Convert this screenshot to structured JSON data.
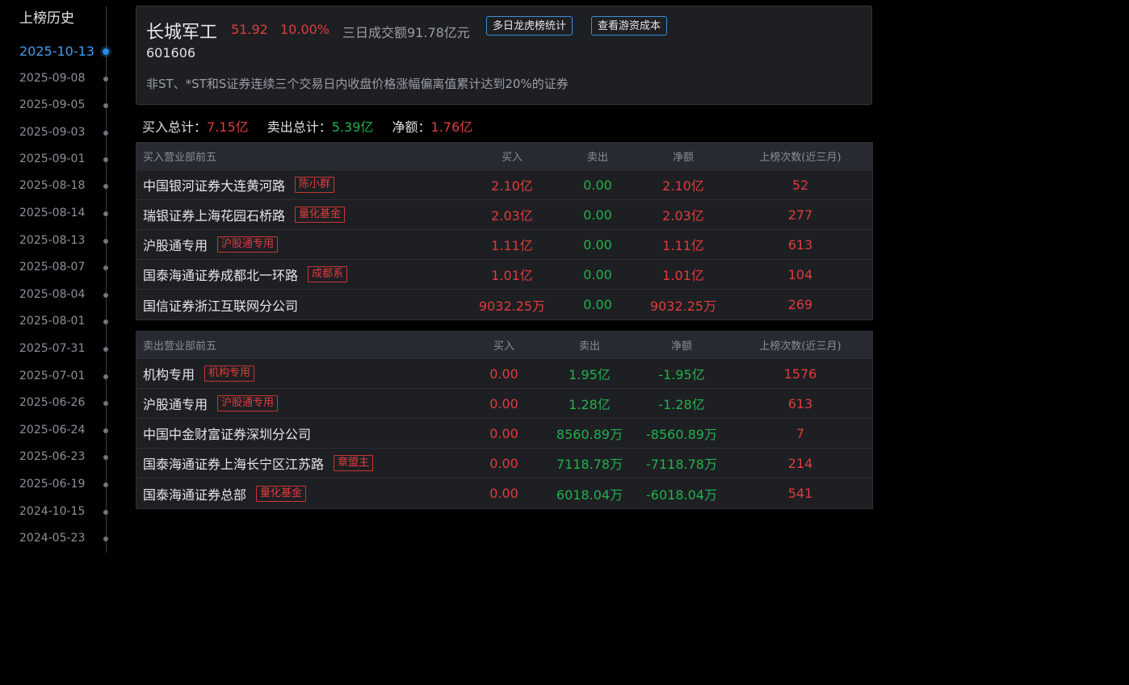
{
  "sidebar": {
    "title": "上榜历史",
    "dates": [
      {
        "label": "2025-10-13",
        "active": true
      },
      {
        "label": "2025-09-08"
      },
      {
        "label": "2025-09-05"
      },
      {
        "label": "2025-09-03"
      },
      {
        "label": "2025-09-01"
      },
      {
        "label": "2025-08-18"
      },
      {
        "label": "2025-08-14"
      },
      {
        "label": "2025-08-13"
      },
      {
        "label": "2025-08-07"
      },
      {
        "label": "2025-08-04"
      },
      {
        "label": "2025-08-01"
      },
      {
        "label": "2025-07-31"
      },
      {
        "label": "2025-07-01"
      },
      {
        "label": "2025-06-26"
      },
      {
        "label": "2025-06-24"
      },
      {
        "label": "2025-06-23"
      },
      {
        "label": "2025-06-19"
      },
      {
        "label": "2024-10-15"
      },
      {
        "label": "2024-05-23"
      }
    ]
  },
  "stock": {
    "name": "长城军工",
    "price": "51.92",
    "change": "10.00%",
    "turnover": "三日成交额91.78亿元",
    "code": "601606",
    "reason": "非ST、*ST和S证券连续三个交易日内收盘价格涨幅偏离值累计达到20%的证券",
    "buttons": {
      "multiday": "多日龙虎榜统计",
      "cost": "查看游资成本"
    }
  },
  "totals": {
    "buy_label": "买入总计：",
    "buy_value": "7.15亿",
    "sell_label": "卖出总计：",
    "sell_value": "5.39亿",
    "net_label": "净额：",
    "net_value": "1.76亿"
  },
  "buy_table": {
    "headers": [
      "买入营业部前五",
      "买入",
      "卖出",
      "净额",
      "上榜次数(近三月)"
    ],
    "rows": [
      {
        "name": "中国银河证券大连黄河路",
        "tag": "陈小群",
        "buy": "2.10亿",
        "sell": "0.00",
        "net": "2.10亿",
        "count": "52"
      },
      {
        "name": "瑞银证券上海花园石桥路",
        "tag": "量化基金",
        "buy": "2.03亿",
        "sell": "0.00",
        "net": "2.03亿",
        "count": "277"
      },
      {
        "name": "沪股通专用",
        "tag": "沪股通专用",
        "buy": "1.11亿",
        "sell": "0.00",
        "net": "1.11亿",
        "count": "613"
      },
      {
        "name": "国泰海通证券成都北一环路",
        "tag": "成都系",
        "buy": "1.01亿",
        "sell": "0.00",
        "net": "1.01亿",
        "count": "104"
      },
      {
        "name": "国信证券浙江互联网分公司",
        "tag": "",
        "buy": "9032.25万",
        "sell": "0.00",
        "net": "9032.25万",
        "count": "269"
      }
    ]
  },
  "sell_table": {
    "headers": [
      "卖出营业部前五",
      "买入",
      "卖出",
      "净额",
      "上榜次数(近三月)"
    ],
    "rows": [
      {
        "name": "机构专用",
        "tag": "机构专用",
        "buy": "0.00",
        "sell": "1.95亿",
        "net": "-1.95亿",
        "count": "1576"
      },
      {
        "name": "沪股通专用",
        "tag": "沪股通专用",
        "buy": "0.00",
        "sell": "1.28亿",
        "net": "-1.28亿",
        "count": "613"
      },
      {
        "name": "中国中金财富证券深圳分公司",
        "tag": "",
        "buy": "0.00",
        "sell": "8560.89万",
        "net": "-8560.89万",
        "count": "7"
      },
      {
        "name": "国泰海通证券上海长宁区江苏路",
        "tag": "章盟主",
        "buy": "0.00",
        "sell": "7118.78万",
        "net": "-7118.78万",
        "count": "214"
      },
      {
        "name": "国泰海通证券总部",
        "tag": "量化基金",
        "buy": "0.00",
        "sell": "6018.04万",
        "net": "-6018.04万",
        "count": "541"
      }
    ]
  },
  "colors": {
    "up": "#e03c3c",
    "down": "#22b14c",
    "accent": "#3f9cf0"
  }
}
